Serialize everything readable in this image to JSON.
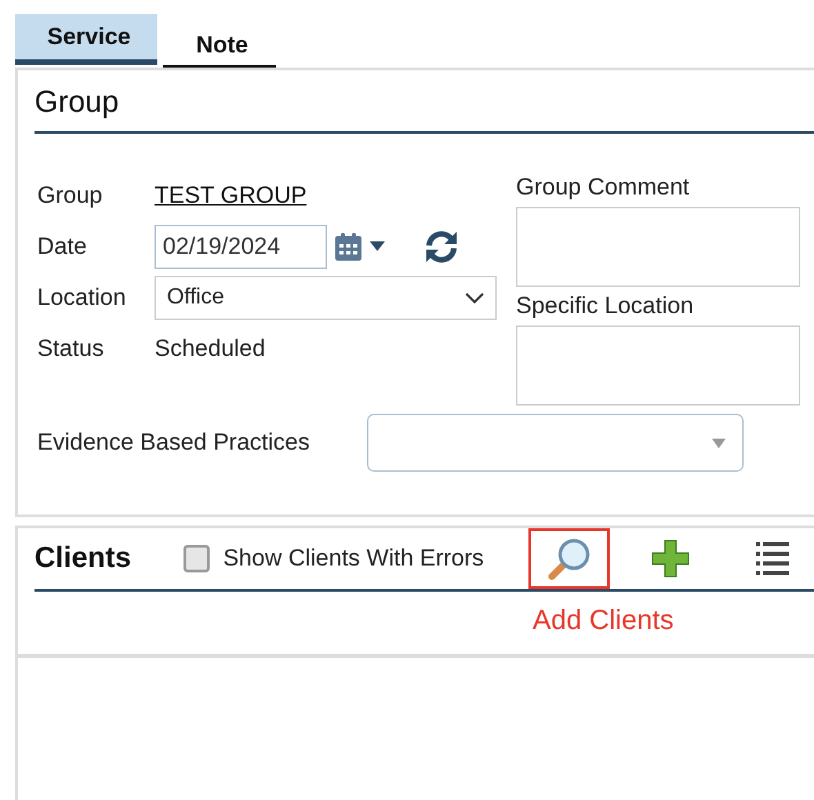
{
  "tabs": [
    {
      "label": "Service",
      "selected": true
    },
    {
      "label": "Note",
      "selected": false
    }
  ],
  "group_section": {
    "title": "Group",
    "fields": [
      {
        "kind": "link",
        "label": "Group",
        "value": "TEST GROUP"
      },
      {
        "kind": "date",
        "label": "Date",
        "value": "02/19/2024"
      },
      {
        "kind": "select",
        "label": "Location",
        "value": "Office"
      },
      {
        "kind": "text",
        "label": "Status",
        "value": "Scheduled"
      }
    ],
    "comment_label": "Group Comment",
    "specific_location_label": "Specific Location",
    "evidence_label": "Evidence Based Practices"
  },
  "clients_section": {
    "title": "Clients",
    "show_errors": {
      "label": "Show Clients With Errors",
      "checked": false
    },
    "tools": [
      {
        "kind": "search",
        "highlighted": true
      },
      {
        "kind": "add",
        "highlighted": false
      },
      {
        "kind": "list",
        "highlighted": false
      }
    ],
    "annotation": "Add Clients"
  }
}
